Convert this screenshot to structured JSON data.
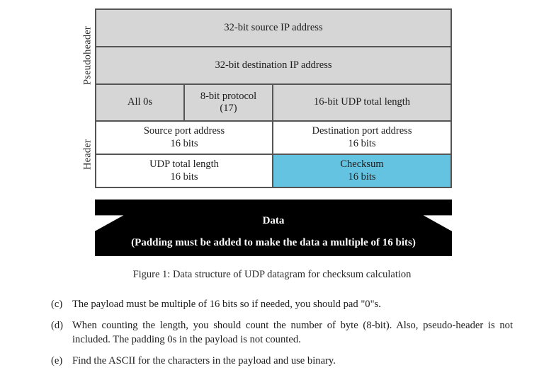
{
  "figure": {
    "side_labels": {
      "pseudoheader": "Pseudoheader",
      "header": "Header"
    },
    "rows": [
      {
        "section": "pseudoheader",
        "cells": [
          {
            "line1": "32-bit source IP address",
            "line2": "",
            "fill": "gray",
            "width": "w100"
          }
        ]
      },
      {
        "section": "pseudoheader",
        "cells": [
          {
            "line1": "32-bit destination IP address",
            "line2": "",
            "fill": "gray",
            "width": "w100"
          }
        ]
      },
      {
        "section": "pseudoheader",
        "cells": [
          {
            "line1": "All 0s",
            "line2": "",
            "fill": "gray",
            "width": "w25"
          },
          {
            "line1": "8-bit protocol",
            "line2": "(17)",
            "fill": "gray",
            "width": "w25"
          },
          {
            "line1": "16-bit UDP total length",
            "line2": "",
            "fill": "gray",
            "width": "w50"
          }
        ]
      },
      {
        "section": "header",
        "cells": [
          {
            "line1": "Source port address",
            "line2": "16 bits",
            "fill": "white",
            "width": "w50"
          },
          {
            "line1": "Destination port address",
            "line2": "16 bits",
            "fill": "white",
            "width": "w50"
          }
        ]
      },
      {
        "section": "header",
        "cells": [
          {
            "line1": "UDP total length",
            "line2": "16 bits",
            "fill": "white",
            "width": "w50"
          },
          {
            "line1": "Checksum",
            "line2": "16 bits",
            "fill": "cyan",
            "width": "w50"
          }
        ]
      }
    ],
    "banner": {
      "title": "Data",
      "subtitle": "(Padding must be added to make the data a multiple of 16 bits)"
    },
    "caption": "Figure 1: Data structure of UDP datagram for checksum calculation"
  },
  "notes": [
    {
      "marker": "(c)",
      "text": "The payload must be multiple of 16 bits so if needed, you should pad \"0\"s."
    },
    {
      "marker": "(d)",
      "text": "When counting the length, you should count the number of byte (8-bit). Also, pseudo-header is not included. The padding 0s in the payload is not counted."
    },
    {
      "marker": "(e)",
      "text": "Find the ASCII for the characters in the payload and use binary."
    }
  ],
  "colors": {
    "pseudoheader_fill": "#d6d6d6",
    "checksum_fill": "#63c3e0",
    "banner_fill": "#000000",
    "border": "#555555"
  }
}
